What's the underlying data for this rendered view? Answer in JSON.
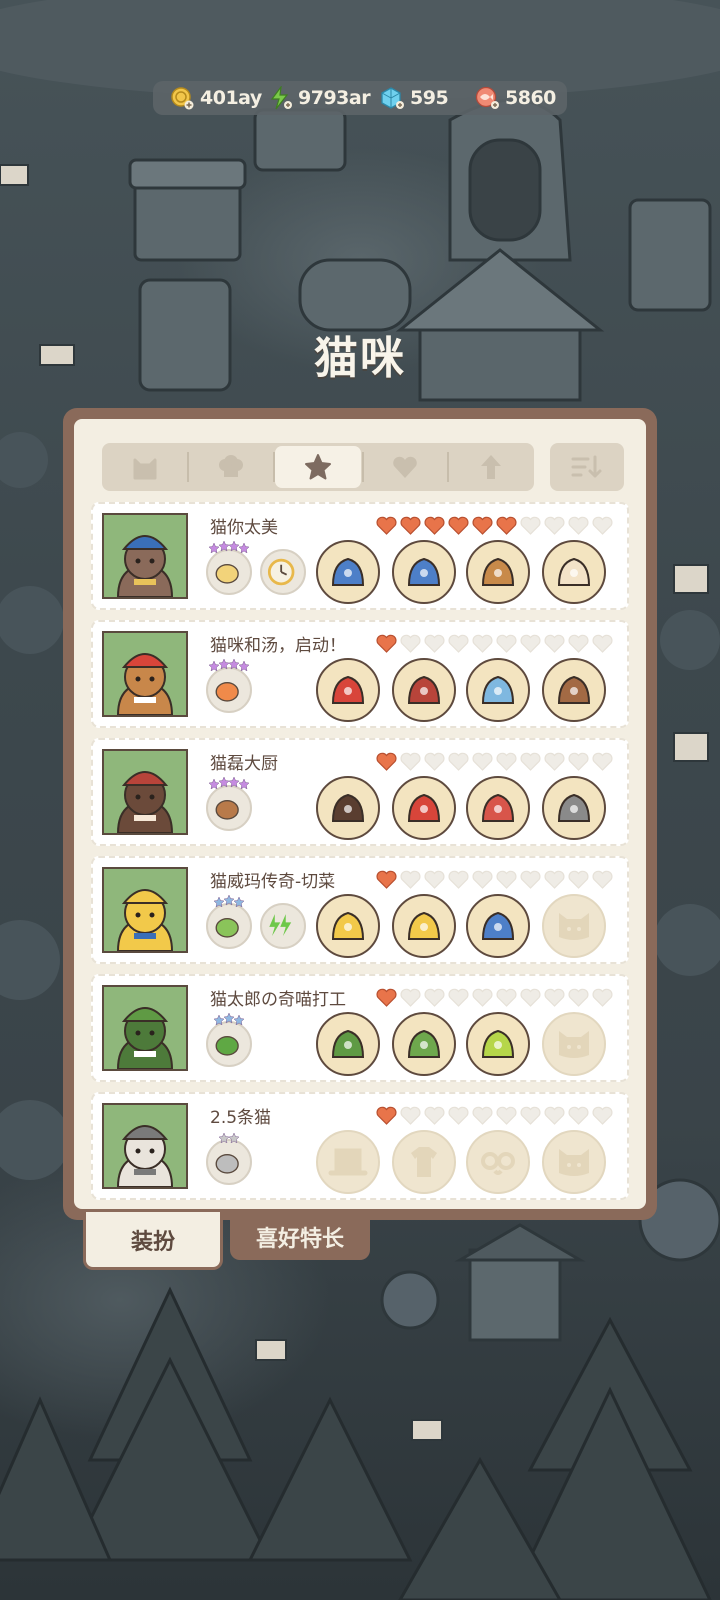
{
  "currencies": [
    {
      "icon": "coin-icon",
      "value": "401ay"
    },
    {
      "icon": "energy-icon",
      "value": "9793ar"
    },
    {
      "icon": "gem-icon",
      "value": "595"
    },
    {
      "icon": "fish-icon",
      "value": "5860"
    }
  ],
  "title": "猫咪",
  "filter_tabs": [
    {
      "icon": "cat-head-icon",
      "active": false
    },
    {
      "icon": "chef-hat-icon",
      "active": false
    },
    {
      "icon": "star-icon",
      "active": true
    },
    {
      "icon": "heart-icon",
      "active": false
    },
    {
      "icon": "arrow-up-icon",
      "active": false
    }
  ],
  "sort_icon": "sort-icon",
  "cats": [
    {
      "name": "猫你太美",
      "hearts": 6,
      "hearts_max": 10,
      "skills": [
        {
          "icon": "noodle-bowl-icon",
          "stars": 4
        },
        {
          "icon": "stopwatch-icon",
          "stars": 0
        }
      ],
      "items": [
        {
          "icon": "blue-cap-icon",
          "locked": false
        },
        {
          "icon": "blue-vest-icon",
          "locked": false
        },
        {
          "icon": "teddy-bear-icon",
          "locked": false
        },
        {
          "icon": "alpaca-icon",
          "locked": false
        }
      ]
    },
    {
      "name": "猫咪和汤，启动！",
      "hearts": 1,
      "hearts_max": 10,
      "skills": [
        {
          "icon": "juice-bottle-icon",
          "stars": 4
        }
      ],
      "items": [
        {
          "icon": "santa-hat-icon",
          "locked": false
        },
        {
          "icon": "red-vest-icon",
          "locked": false
        },
        {
          "icon": "moon-pillow-icon",
          "locked": false
        },
        {
          "icon": "reindeer-icon",
          "locked": false
        }
      ]
    },
    {
      "name": "猫磊大厨",
      "hearts": 1,
      "hearts_max": 10,
      "skills": [
        {
          "icon": "skewer-icon",
          "stars": 4
        }
      ],
      "items": [
        {
          "icon": "braid-wig-icon",
          "locked": false
        },
        {
          "icon": "red-dress-icon",
          "locked": false
        },
        {
          "icon": "flower-wreath-icon",
          "locked": false
        },
        {
          "icon": "raccoon-icon",
          "locked": false
        }
      ]
    },
    {
      "name": "猫威玛传奇-切菜",
      "hearts": 1,
      "hearts_max": 10,
      "skills": [
        {
          "icon": "celery-icon",
          "stars": 3
        },
        {
          "icon": "double-bolt-icon",
          "stars": 0
        }
      ],
      "items": [
        {
          "icon": "cat-hood-icon",
          "locked": false
        },
        {
          "icon": "yellow-raincoat-icon",
          "locked": false
        },
        {
          "icon": "umbrella-icon",
          "locked": false
        },
        {
          "icon": "locked-pet-icon",
          "locked": true
        }
      ]
    },
    {
      "name": "猫太郎の奇喵打工",
      "hearts": 1,
      "hearts_max": 10,
      "skills": [
        {
          "icon": "broccoli-icon",
          "stars": 3
        }
      ],
      "items": [
        {
          "icon": "green-hood-icon",
          "locked": false
        },
        {
          "icon": "green-coat-icon",
          "locked": false
        },
        {
          "icon": "bird-icon",
          "locked": false
        },
        {
          "icon": "locked-pet-icon",
          "locked": true
        }
      ]
    },
    {
      "name": "2.5条猫",
      "hearts": 1,
      "hearts_max": 10,
      "skills": [
        {
          "icon": "empty-bottle-icon",
          "stars": 2
        }
      ],
      "items": [
        {
          "icon": "locked-hat-icon",
          "locked": true
        },
        {
          "icon": "locked-shirt-icon",
          "locked": true
        },
        {
          "icon": "locked-glasses-icon",
          "locked": true
        },
        {
          "icon": "locked-pet-icon",
          "locked": true
        }
      ]
    }
  ],
  "bottom_tabs": [
    {
      "label": "装扮",
      "active": true
    },
    {
      "label": "喜好特长",
      "active": false
    }
  ],
  "colors": {
    "heart_filled": "#e8744a",
    "heart_empty": "#efece6",
    "star": "#c58be0",
    "panel_border": "#8a6a5a",
    "portrait_bg": "#8fb77b"
  }
}
